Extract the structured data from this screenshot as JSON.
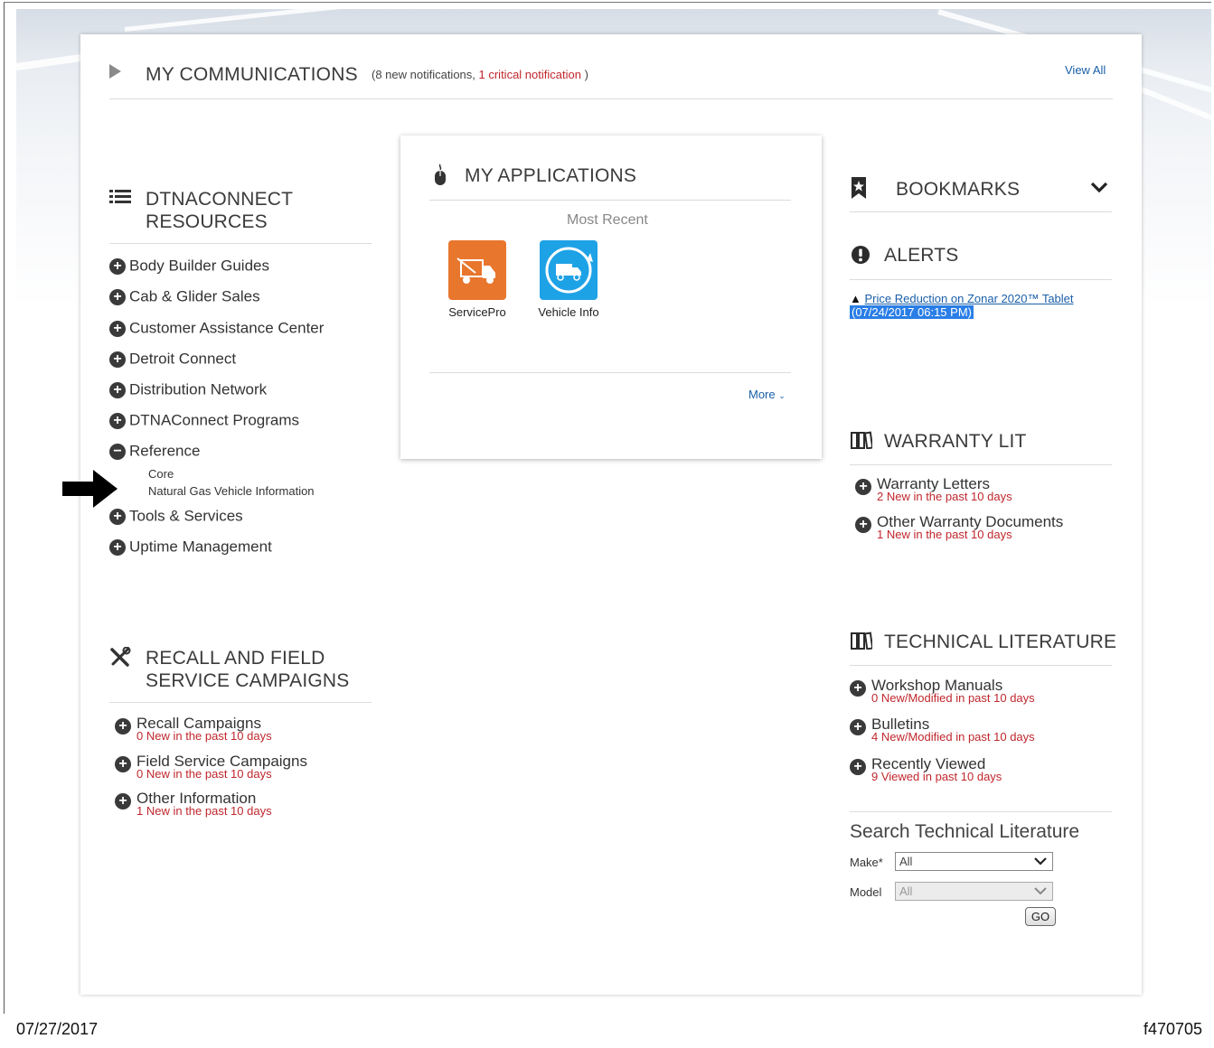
{
  "communications": {
    "title": "MY COMMUNICATIONS",
    "count_prefix": "(8 new notifications, ",
    "count_critical": "1 critical notification",
    "count_suffix": " )",
    "view_all": "View All"
  },
  "resources": {
    "title_line1": "DTNACONNECT",
    "title_line2": "RESOURCES",
    "items": [
      {
        "label": "Body Builder Guides",
        "icon": "+"
      },
      {
        "label": "Cab & Glider Sales",
        "icon": "+"
      },
      {
        "label": "Customer Assistance Center",
        "icon": "+"
      },
      {
        "label": "Detroit Connect",
        "icon": "+"
      },
      {
        "label": "Distribution Network",
        "icon": "+"
      },
      {
        "label": "DTNAConnect Programs",
        "icon": "+"
      },
      {
        "label": "Reference",
        "icon": "−"
      },
      {
        "label": "Tools & Services",
        "icon": "+"
      },
      {
        "label": "Uptime Management",
        "icon": "+"
      }
    ],
    "reference_subitems": [
      "Core",
      "Natural Gas Vehicle Information"
    ]
  },
  "recall": {
    "title_line1": "RECALL AND FIELD",
    "title_line2": "SERVICE CAMPAIGNS",
    "items": [
      {
        "label": "Recall Campaigns",
        "sub": "0 New in the past 10 days"
      },
      {
        "label": "Field Service Campaigns",
        "sub": "0 New in the past 10 days"
      },
      {
        "label": "Other Information",
        "sub": "1 New in the past 10 days"
      }
    ]
  },
  "applications": {
    "title": "MY APPLICATIONS",
    "most_recent": "Most Recent",
    "apps": [
      {
        "label": "ServicePro",
        "color": "#e8762d"
      },
      {
        "label": "Vehicle Info",
        "color": "#1ea2e6"
      }
    ],
    "more": "More"
  },
  "bookmarks": {
    "title": "BOOKMARKS"
  },
  "alerts": {
    "title": "ALERTS",
    "link": "Price Reduction on Zonar 2020™ Tablet",
    "date": "(07/24/2017 06:15 PM)"
  },
  "warranty": {
    "title": "WARRANTY LIT",
    "items": [
      {
        "label": "Warranty Letters",
        "sub": "2 New in the past 10 days"
      },
      {
        "label": "Other Warranty Documents",
        "sub": "1 New in the past 10 days"
      }
    ]
  },
  "technical": {
    "title": "TECHNICAL LITERATURE",
    "items": [
      {
        "label": "Workshop Manuals",
        "sub": "0 New/Modified in past 10 days"
      },
      {
        "label": "Bulletins",
        "sub": "4 New/Modified in past 10 days"
      },
      {
        "label": "Recently Viewed",
        "sub": "9 Viewed in past 10 days"
      }
    ]
  },
  "search": {
    "title": "Search Technical Literature",
    "make_label": "Make*",
    "make_value": "All",
    "model_label": "Model",
    "model_value": "All",
    "go": "GO"
  },
  "footer": {
    "date": "07/27/2017",
    "figure_id": "f470705"
  },
  "colors": {
    "critical_red": "#c0272d",
    "link_blue": "#1a5fa8",
    "highlight_blue": "#2a7ee6",
    "servicepro_orange": "#e8762d",
    "vehicleinfo_blue": "#1ea2e6"
  }
}
